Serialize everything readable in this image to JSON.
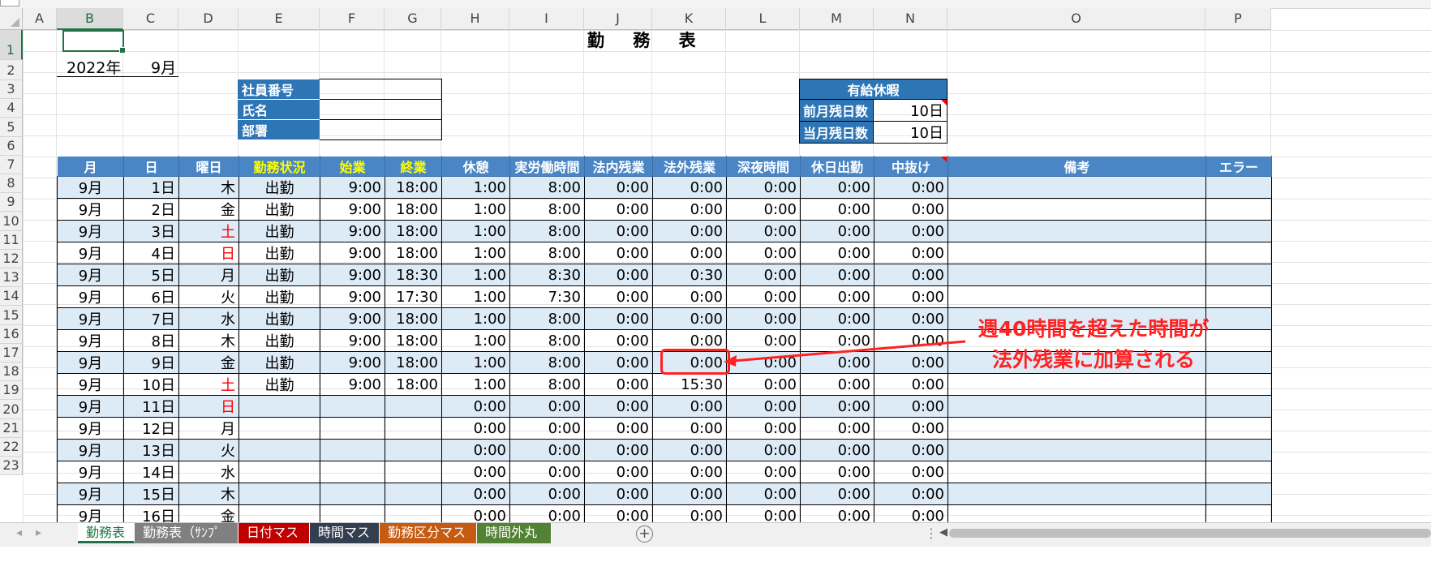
{
  "columns": [
    "A",
    "B",
    "C",
    "D",
    "E",
    "F",
    "G",
    "H",
    "I",
    "J",
    "K",
    "L",
    "M",
    "N",
    "O",
    "P"
  ],
  "rows": [
    "1",
    "2",
    "3",
    "4",
    "5",
    "6",
    "7",
    "8",
    "9",
    "10",
    "11",
    "12",
    "13",
    "14",
    "15",
    "16",
    "17",
    "18",
    "19",
    "20",
    "21",
    "22",
    "23"
  ],
  "title": "勤 務 表",
  "year": "2022年",
  "month": "9月",
  "employee": {
    "labels": [
      "社員番号",
      "氏名",
      "部署"
    ]
  },
  "paid_leave": {
    "header": "有給休暇",
    "rows": [
      {
        "label": "前月残日数",
        "value": "10日"
      },
      {
        "label": "当月残日数",
        "value": "10日"
      }
    ]
  },
  "table": {
    "headers": [
      "月",
      "日",
      "曜日",
      "勤務状況",
      "始業",
      "終業",
      "休憩",
      "実労働時間",
      "法内残業",
      "法外残業",
      "深夜時間",
      "休日出勤",
      "中抜け",
      "備考",
      "エラー"
    ],
    "rows": [
      [
        "9月",
        "1日",
        "木",
        "出勤",
        "9:00",
        "18:00",
        "1:00",
        "8:00",
        "0:00",
        "0:00",
        "0:00",
        "0:00",
        "0:00"
      ],
      [
        "9月",
        "2日",
        "金",
        "出勤",
        "9:00",
        "18:00",
        "1:00",
        "8:00",
        "0:00",
        "0:00",
        "0:00",
        "0:00",
        "0:00"
      ],
      [
        "9月",
        "3日",
        "土",
        "出勤",
        "9:00",
        "18:00",
        "1:00",
        "8:00",
        "0:00",
        "0:00",
        "0:00",
        "0:00",
        "0:00"
      ],
      [
        "9月",
        "4日",
        "日",
        "出勤",
        "9:00",
        "18:00",
        "1:00",
        "8:00",
        "0:00",
        "0:00",
        "0:00",
        "0:00",
        "0:00"
      ],
      [
        "9月",
        "5日",
        "月",
        "出勤",
        "9:00",
        "18:30",
        "1:00",
        "8:30",
        "0:00",
        "0:30",
        "0:00",
        "0:00",
        "0:00"
      ],
      [
        "9月",
        "6日",
        "火",
        "出勤",
        "9:00",
        "17:30",
        "1:00",
        "7:30",
        "0:00",
        "0:00",
        "0:00",
        "0:00",
        "0:00"
      ],
      [
        "9月",
        "7日",
        "水",
        "出勤",
        "9:00",
        "18:00",
        "1:00",
        "8:00",
        "0:00",
        "0:00",
        "0:00",
        "0:00",
        "0:00"
      ],
      [
        "9月",
        "8日",
        "木",
        "出勤",
        "9:00",
        "18:00",
        "1:00",
        "8:00",
        "0:00",
        "0:00",
        "0:00",
        "0:00",
        "0:00"
      ],
      [
        "9月",
        "9日",
        "金",
        "出勤",
        "9:00",
        "18:00",
        "1:00",
        "8:00",
        "0:00",
        "0:00",
        "0:00",
        "0:00",
        "0:00"
      ],
      [
        "9月",
        "10日",
        "土",
        "出勤",
        "9:00",
        "18:00",
        "1:00",
        "8:00",
        "0:00",
        "15:30",
        "0:00",
        "0:00",
        "0:00"
      ],
      [
        "9月",
        "11日",
        "日",
        "",
        "",
        "",
        "0:00",
        "0:00",
        "0:00",
        "0:00",
        "0:00",
        "0:00",
        "0:00"
      ],
      [
        "9月",
        "12日",
        "月",
        "",
        "",
        "",
        "0:00",
        "0:00",
        "0:00",
        "0:00",
        "0:00",
        "0:00",
        "0:00"
      ],
      [
        "9月",
        "13日",
        "火",
        "",
        "",
        "",
        "0:00",
        "0:00",
        "0:00",
        "0:00",
        "0:00",
        "0:00",
        "0:00"
      ],
      [
        "9月",
        "14日",
        "水",
        "",
        "",
        "",
        "0:00",
        "0:00",
        "0:00",
        "0:00",
        "0:00",
        "0:00",
        "0:00"
      ],
      [
        "9月",
        "15日",
        "木",
        "",
        "",
        "",
        "0:00",
        "0:00",
        "0:00",
        "0:00",
        "0:00",
        "0:00",
        "0:00"
      ],
      [
        "9月",
        "16日",
        "金",
        "",
        "",
        "",
        "0:00",
        "0:00",
        "0:00",
        "0:00",
        "0:00",
        "0:00",
        "0:00"
      ]
    ],
    "weekend_red": [
      "土",
      "日"
    ]
  },
  "callout": {
    "line1": "週40時間を超えた時間が",
    "line2": "法外残業に加算される",
    "color": "#ff2222"
  },
  "sheet_tabs": [
    {
      "label": "勤務表",
      "color": "#ffffff"
    },
    {
      "label": "勤務表（ｻﾝﾌﾟﾙ）",
      "color": "#808080"
    },
    {
      "label": "日付マスタ",
      "color": "#c00000"
    },
    {
      "label": "時間マスタ",
      "color": "#333f50"
    },
    {
      "label": "勤務区分マスタ",
      "color": "#c55a11"
    },
    {
      "label": "時間外丸め",
      "color": "#548235"
    }
  ],
  "icons": {
    "add_sheet": "plus-circle-icon",
    "nav_left": "triangle-left-icon",
    "nav_right": "triangle-right-icon"
  }
}
